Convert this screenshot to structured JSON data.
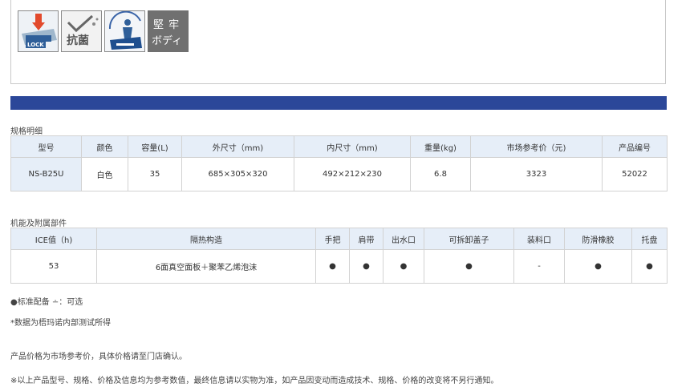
{
  "feature_icons": [
    {
      "name": "lock-icon",
      "label": "LOCK"
    },
    {
      "name": "antibacterial-icon",
      "label": "抗菌"
    },
    {
      "name": "weight-bearing-icon",
      "label": ""
    },
    {
      "name": "sturdy-body-icon",
      "label_line1": "堅 牢",
      "label_line2": "ボディ"
    }
  ],
  "spec": {
    "title": "规格明细",
    "headers": [
      "型号",
      "颜色",
      "容量(L)",
      "外尺寸（mm)",
      "内尺寸（mm)",
      "重量(kg)",
      "市场参考价（元)",
      "产品编号"
    ],
    "row": [
      "NS-B25U",
      "白色",
      "35",
      "685×305×320",
      "492×212×230",
      "6.8",
      "3323",
      "52022"
    ]
  },
  "features": {
    "title": "机能及附属部件",
    "headers": [
      "ICE值（h)",
      "隔热构造",
      "手把",
      "肩带",
      "出水口",
      "可拆卸盖子",
      "装料口",
      "防滑橡胶",
      "托盘"
    ],
    "row": [
      "53",
      "6面真空面板＋聚苯乙烯泡沫",
      "●",
      "●",
      "●",
      "●",
      "-",
      "●",
      "●"
    ]
  },
  "notes": {
    "legend": "●标准配备 ∸：可选",
    "test_note": "*数据为梧玛诺内部测试所得",
    "price_note": "产品价格为市场参考价，具体价格请至门店确认。",
    "disclaimer": "※以上产品型号、规格、价格及信息均为参考数值，最终信息请以实物为准，如产品因变动而造成技术、规格、价格的改变将不另行通知。"
  },
  "colors": {
    "accent_bar": "#2b4799",
    "header_bg": "#e6eef8"
  }
}
